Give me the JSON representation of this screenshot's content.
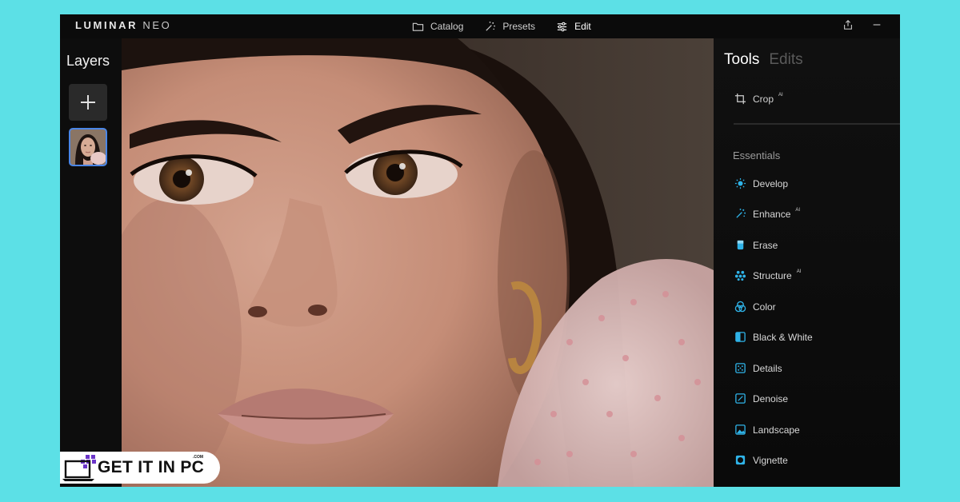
{
  "brand": {
    "name": "LUMINAR",
    "suffix": "NEO"
  },
  "nav": {
    "catalog": "Catalog",
    "presets": "Presets",
    "edit": "Edit"
  },
  "layers": {
    "title": "Layers"
  },
  "tools_panel": {
    "tab_tools": "Tools",
    "tab_edits": "Edits",
    "crop": {
      "label": "Crop",
      "badge": "AI"
    },
    "section": "Essentials",
    "items": [
      {
        "label": "Develop",
        "badge": ""
      },
      {
        "label": "Enhance",
        "badge": "AI"
      },
      {
        "label": "Erase",
        "badge": ""
      },
      {
        "label": "Structure",
        "badge": "AI"
      },
      {
        "label": "Color",
        "badge": ""
      },
      {
        "label": "Black & White",
        "badge": ""
      },
      {
        "label": "Details",
        "badge": ""
      },
      {
        "label": "Denoise",
        "badge": ""
      },
      {
        "label": "Landscape",
        "badge": ""
      },
      {
        "label": "Vignette",
        "badge": ""
      }
    ]
  },
  "watermark": {
    "text": "GET IT IN PC",
    "domain": ".COM"
  },
  "colors": {
    "accent": "#2fb3e8",
    "selection": "#4a86e8",
    "background": "#5ce0e6"
  }
}
